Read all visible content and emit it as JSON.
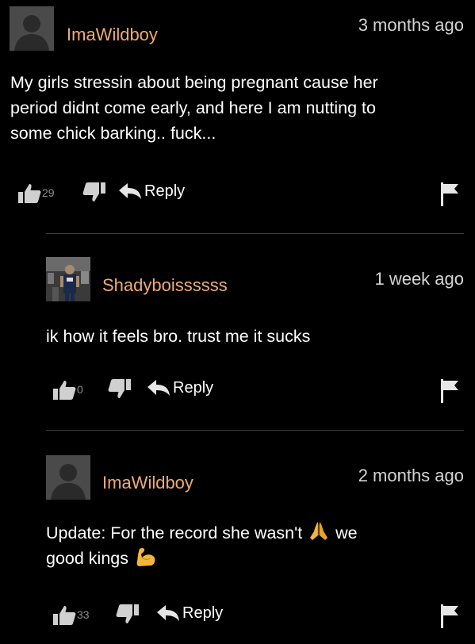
{
  "accent": "#f0ab72",
  "comments": [
    {
      "username": "ImaWildboy",
      "timestamp": "3 months ago",
      "lines": [
        "My girls stressin about being pregnant cause her",
        "period didnt come early, and here I am nutting to",
        "some chick barking.. fuck..."
      ],
      "likes": "29",
      "reply_label": "Reply",
      "avatar": "default-avatar-icon"
    },
    {
      "username": "Shadyboissssss",
      "timestamp": "1 week ago",
      "lines": [
        "ik how it feels bro. trust me it sucks"
      ],
      "likes": "0",
      "reply_label": "Reply",
      "avatar": "user-photo-avatar"
    },
    {
      "username": "ImaWildboy",
      "timestamp": "2 months ago",
      "line1": "Update: For the record she wasn't",
      "line1_end": "we",
      "line2": "good kings",
      "likes": "33",
      "reply_label": "Reply",
      "avatar": "default-avatar-icon",
      "emojis": [
        "folded-hands-emoji",
        "flexed-biceps-emoji"
      ]
    }
  ]
}
